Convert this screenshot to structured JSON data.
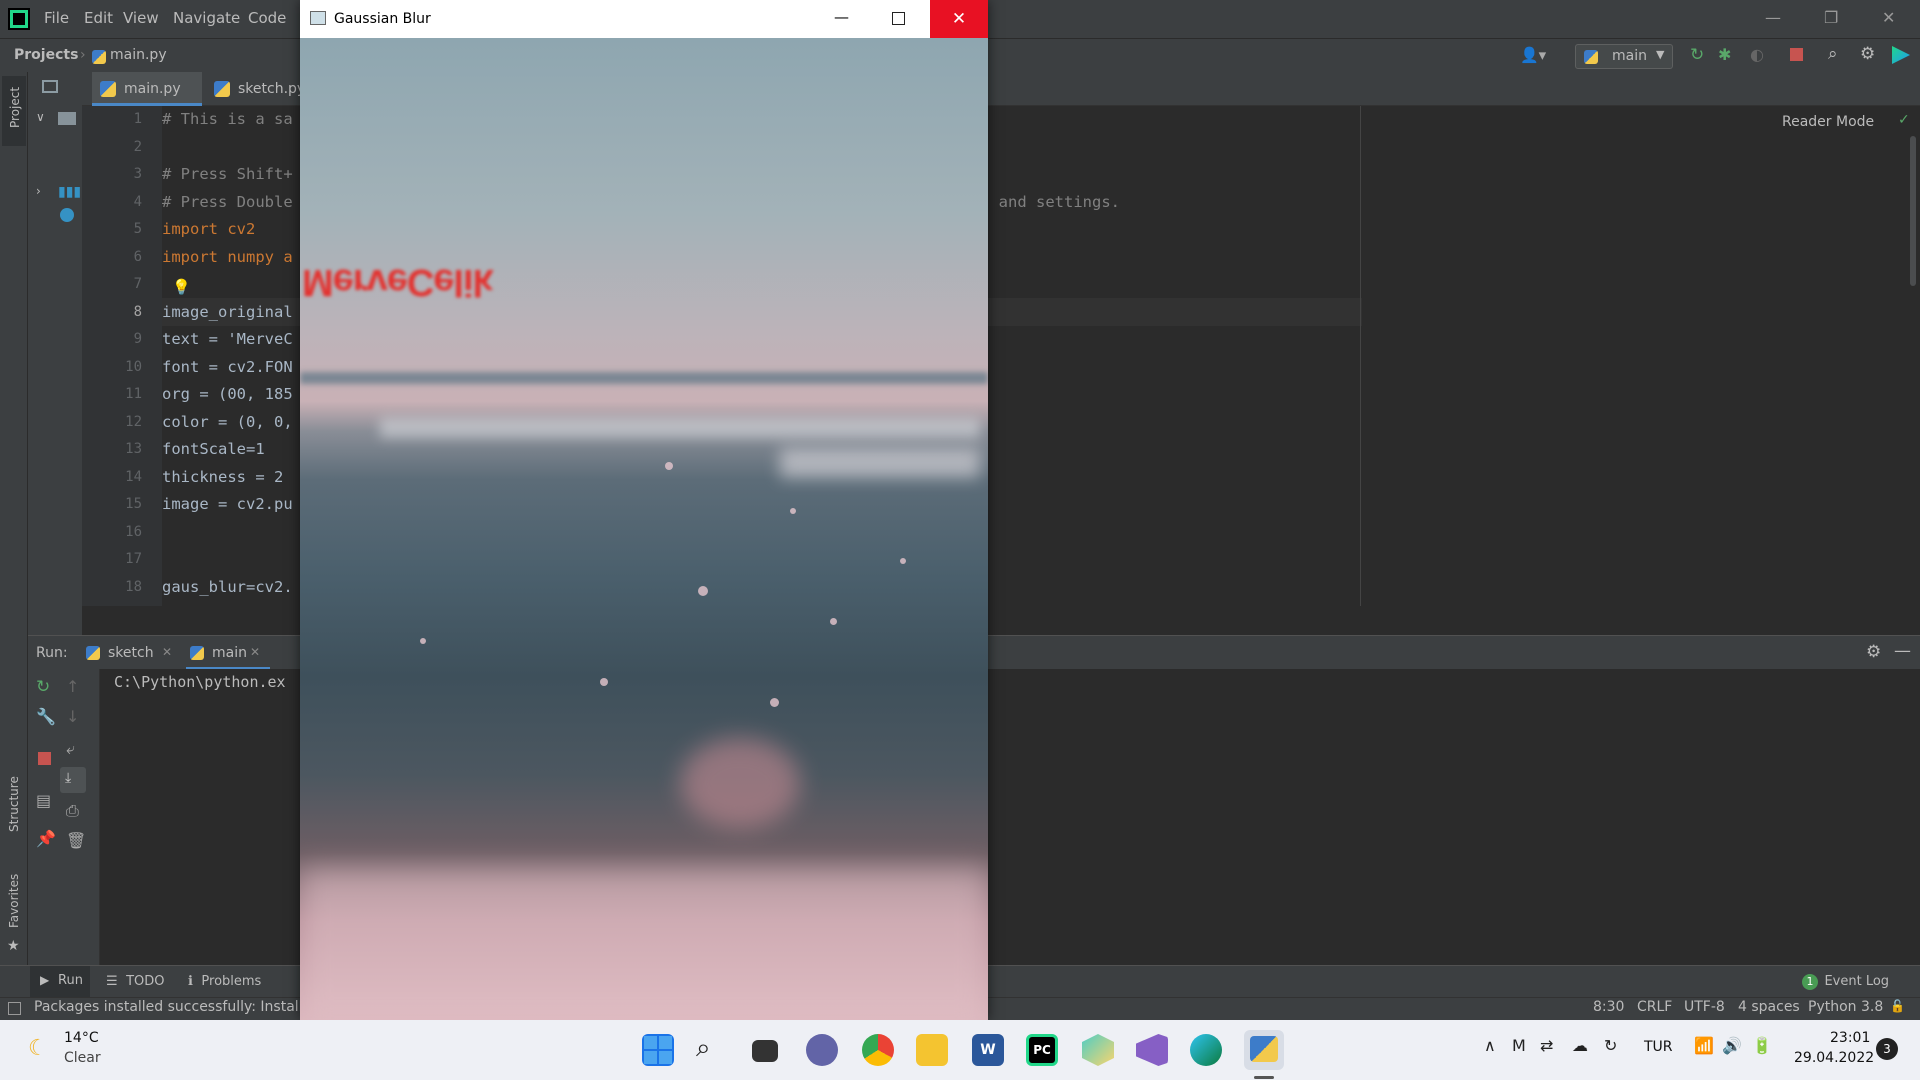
{
  "menu": [
    "File",
    "Edit",
    "View",
    "Navigate",
    "Code"
  ],
  "nav": {
    "projects": "Projects",
    "file": "main.py",
    "run_config": "main"
  },
  "tabs": [
    {
      "label": "main.py"
    },
    {
      "label": "sketch.py"
    }
  ],
  "editor": {
    "reader_mode": "Reader Mode",
    "line_numbers": [
      "1",
      "2",
      "3",
      "4",
      "5",
      "6",
      "7",
      "8",
      "9",
      "10",
      "11",
      "12",
      "13",
      "14",
      "15",
      "16",
      "17",
      "18"
    ],
    "lines": [
      "# This is a sa",
      "",
      "# Press Shift+",
      "# Press Double",
      "import cv2",
      "import numpy a",
      "",
      "image_original",
      "text = 'MerveC",
      "font = cv2.FON",
      "org = (00, 185",
      "color = (0, 0,",
      "fontScale=1",
      "thickness = 2",
      "image = cv2.pu",
      "",
      "",
      "gaus_blur=cv2."
    ],
    "line4_tail": ", and settings."
  },
  "side_labels": {
    "project": "Project",
    "structure": "Structure",
    "favorites": "Favorites"
  },
  "run": {
    "label": "Run:",
    "tabs": [
      "sketch",
      "main"
    ],
    "output": "C:\\Python\\python.ex"
  },
  "bottom_tabs": [
    "Run",
    "TODO",
    "Problems"
  ],
  "event_log": {
    "count": "1",
    "label": "Event Log"
  },
  "status": {
    "message": "Packages installed successfully: Installed",
    "position": "8:30",
    "line_sep": "CRLF",
    "encoding": "UTF-8",
    "indent": "4 spaces",
    "interpreter": "Python 3.8"
  },
  "cv_window": {
    "title": "Gaussian Blur",
    "overlay_text": "MerveCelik"
  },
  "taskbar": {
    "temp": "14°C",
    "weather": "Clear",
    "lang": "TUR",
    "time": "23:01",
    "date": "29.04.2022",
    "notif": "3"
  }
}
